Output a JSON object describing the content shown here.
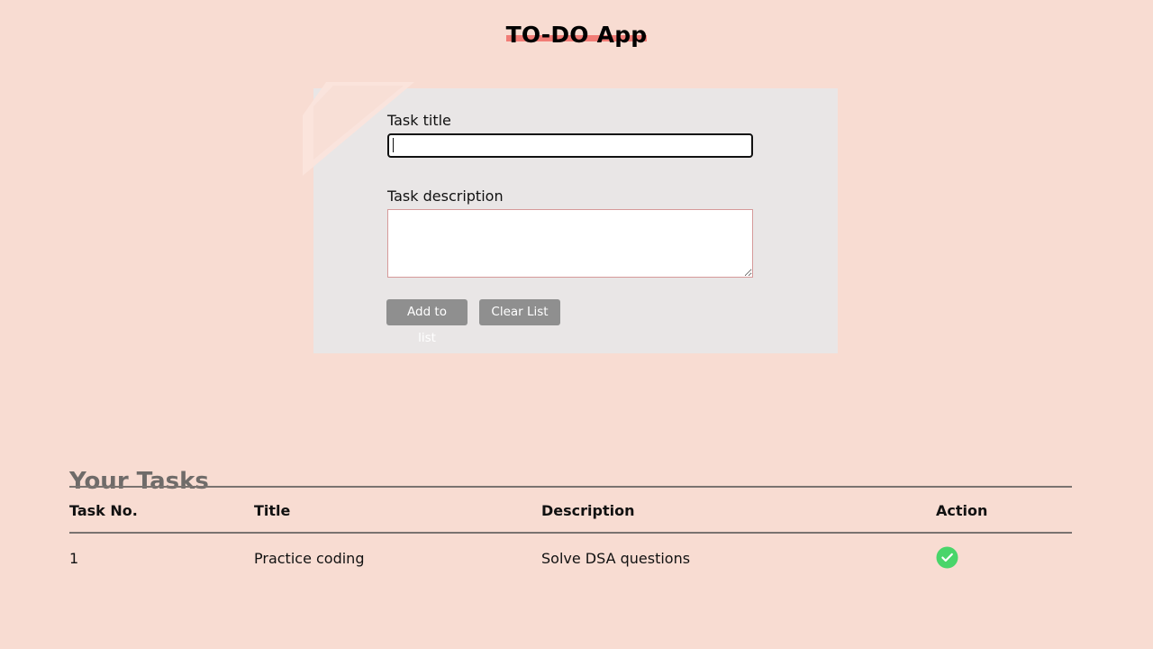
{
  "app": {
    "title": "TO-DO App"
  },
  "form": {
    "title_label": "Task title",
    "title_value": "",
    "description_label": "Task description",
    "description_value": "",
    "add_button_label": "Add to list",
    "clear_button_label": "Clear List"
  },
  "tasks": {
    "heading": "Your Tasks",
    "columns": [
      "Task No.",
      "Title",
      "Description",
      "Action"
    ],
    "rows": [
      {
        "number": "1",
        "title": "Practice coding",
        "description": "Solve DSA questions",
        "action_icon": "check-circle-icon"
      }
    ]
  },
  "colors": {
    "background": "#f8dcd2",
    "card": "#e9e6e6",
    "title_highlight": "#f06b66",
    "button": "#8f8f8f",
    "heading_gray": "#6f6b69",
    "action_green": "#49d56a"
  }
}
